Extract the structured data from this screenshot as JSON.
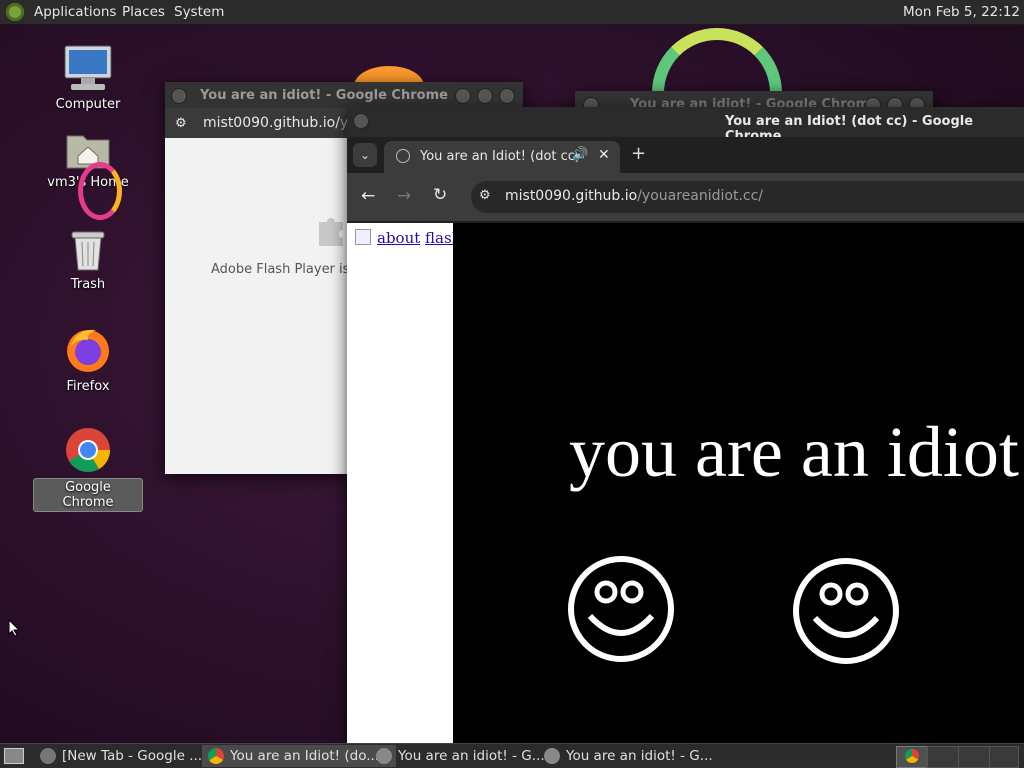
{
  "top_panel": {
    "menus": [
      "Applications",
      "Places",
      "System"
    ],
    "clock": "Mon Feb  5, 22:12"
  },
  "desktop_icons": [
    {
      "label": "Computer"
    },
    {
      "label": "vm3's Home"
    },
    {
      "label": "Trash"
    },
    {
      "label": "Firefox"
    },
    {
      "label": "Google Chrome"
    }
  ],
  "back_window_1": {
    "title": "You are an idiot! - Google Chrome",
    "url_host": "mist0090.github.io/",
    "url_path": "you",
    "plugin_message": "Adobe Flash Player is no"
  },
  "back_window_2": {
    "title": "You are an idiot! - Google Chrome"
  },
  "front_window": {
    "title": "You are an Idiot! (dot cc) - Google Chrome",
    "tab_title": "You are an Idiot! (dot cc)",
    "url_host": "mist0090.github.io",
    "url_path": "/youareanidiot.cc/",
    "links": [
      "about",
      "flash"
    ],
    "headline": "you are an idiot"
  },
  "taskbar": {
    "tasks": [
      {
        "label": "[New Tab - Google ..."
      },
      {
        "label": "You are an Idiot! (do..."
      },
      {
        "label": "You are an idiot! - G..."
      },
      {
        "label": "You are an idiot! - G..."
      }
    ]
  }
}
